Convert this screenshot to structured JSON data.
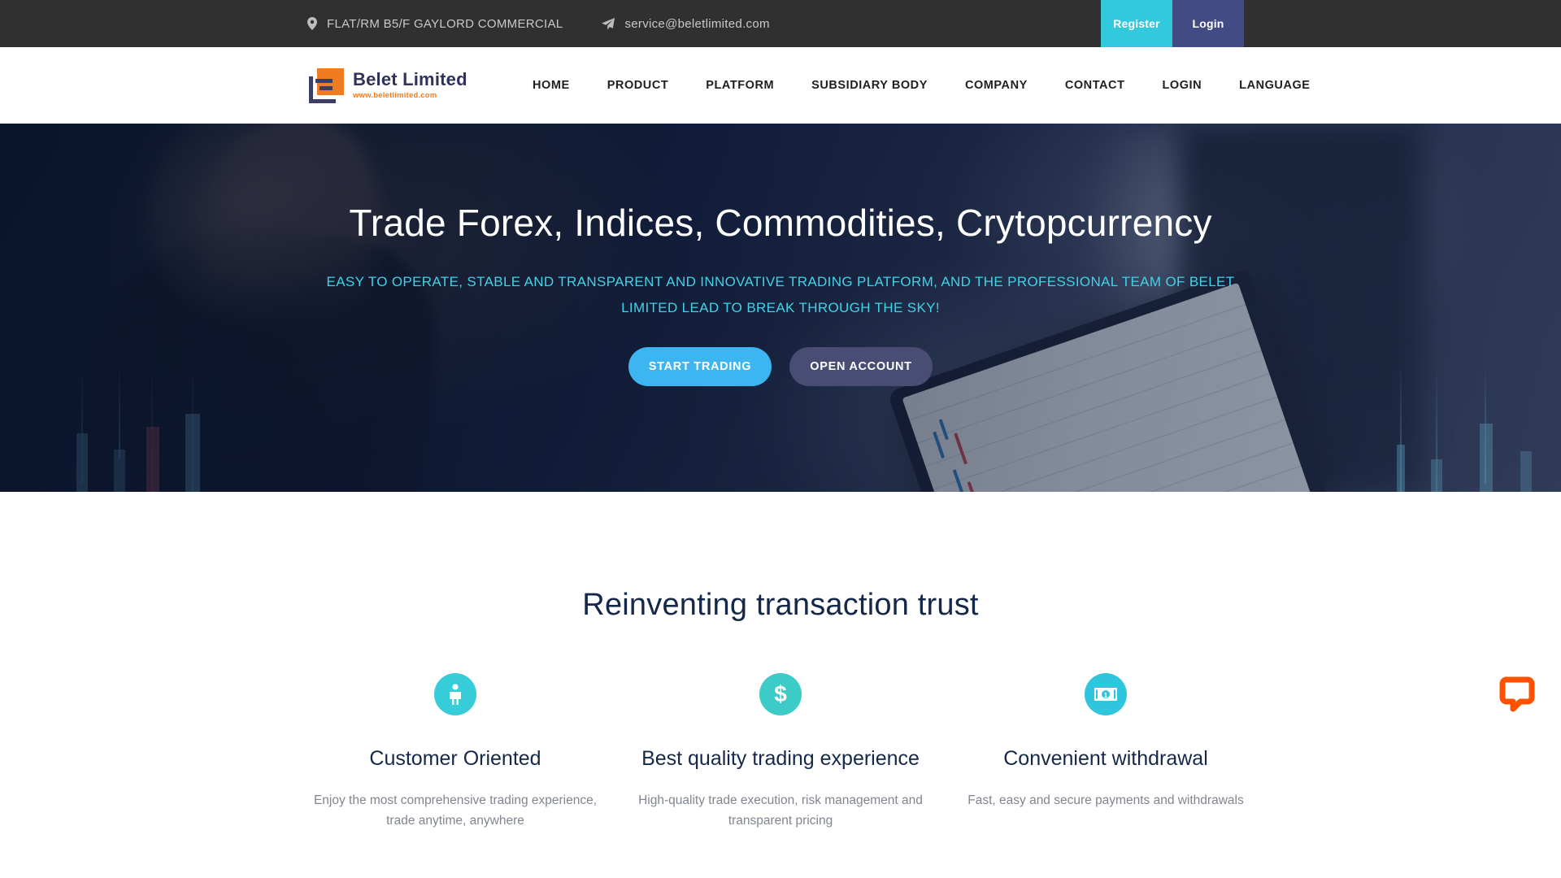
{
  "topbar": {
    "address_icon": "map-pin-icon",
    "address": "FLAT/RM B5/F GAYLORD COMMERCIAL",
    "email_icon": "paper-plane-icon",
    "email": "service@beletlimited.com",
    "register_label": "Register",
    "login_label": "Login",
    "register_color": "#33c9dd",
    "login_color": "#434b85",
    "background": "#303030"
  },
  "brand": {
    "logo_icon": "belet-logo-icon",
    "name": "Belet Limited",
    "url": "www.beletlimited.com",
    "name_color": "#2e3357",
    "url_color": "#f07c22",
    "mark_orange": "#f07c22",
    "mark_navy": "#3c3f63"
  },
  "nav": {
    "items": [
      {
        "label": "HOME"
      },
      {
        "label": "PRODUCT"
      },
      {
        "label": "PLATFORM"
      },
      {
        "label": "SUBSIDIARY BODY"
      },
      {
        "label": "COMPANY"
      },
      {
        "label": "CONTACT"
      },
      {
        "label": "LOGIN"
      },
      {
        "label": "LANGUAGE"
      }
    ]
  },
  "hero": {
    "title": "Trade Forex, Indices, Commodities, Crytopcurrency",
    "subtitle": "EASY TO OPERATE, STABLE AND TRANSPARENT AND INNOVATIVE TRADING PLATFORM, AND THE PROFESSIONAL TEAM OF BELET LIMITED LEAD TO BREAK THROUGH THE SKY!",
    "subtitle_color": "#3fd3e8",
    "primary_button": "START TRADING",
    "secondary_button": "OPEN ACCOUNT",
    "primary_color": "#3cb5f0",
    "secondary_color": "#4a4d73"
  },
  "features": {
    "heading": "Reinventing transaction trust",
    "heading_color": "#16284a",
    "cards": [
      {
        "icon": "person-icon",
        "icon_color": "#36cdd8",
        "title": "Customer Oriented",
        "desc": "Enjoy the most comprehensive trading experience, trade anytime, anywhere"
      },
      {
        "icon": "dollar-sign-icon",
        "icon_color": "#3ccbc6",
        "title": "Best quality trading experience",
        "desc": "High-quality trade execution, risk management and transparent pricing"
      },
      {
        "icon": "banknote-icon",
        "icon_color": "#2fc5dd",
        "title": "Convenient withdrawal",
        "desc": "Fast, easy and secure payments and withdrawals"
      }
    ]
  },
  "chat": {
    "icon": "chat-bubble-icon",
    "color": "#ff5100"
  }
}
